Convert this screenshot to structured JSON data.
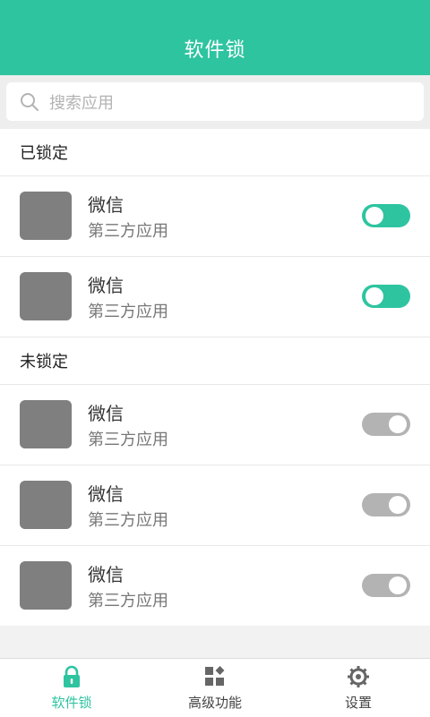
{
  "header": {
    "title": "软件锁"
  },
  "search": {
    "placeholder": "搜索应用"
  },
  "sections": {
    "locked": {
      "title": "已锁定",
      "items": [
        {
          "name": "微信",
          "type": "第三方应用",
          "enabled": true
        },
        {
          "name": "微信",
          "type": "第三方应用",
          "enabled": true
        }
      ]
    },
    "unlocked": {
      "title": "未锁定",
      "items": [
        {
          "name": "微信",
          "type": "第三方应用",
          "enabled": false
        },
        {
          "name": "微信",
          "type": "第三方应用",
          "enabled": false
        },
        {
          "name": "微信",
          "type": "第三方应用",
          "enabled": false
        }
      ]
    }
  },
  "tabs": [
    {
      "label": "软件锁",
      "icon": "lock-icon",
      "active": true
    },
    {
      "label": "高级功能",
      "icon": "grid-icon",
      "active": false
    },
    {
      "label": "设置",
      "icon": "gear-icon",
      "active": false
    }
  ],
  "colors": {
    "accent": "#2ec4a0",
    "toggle_off": "#b3b3b3",
    "app_icon": "#7f7f7f"
  }
}
